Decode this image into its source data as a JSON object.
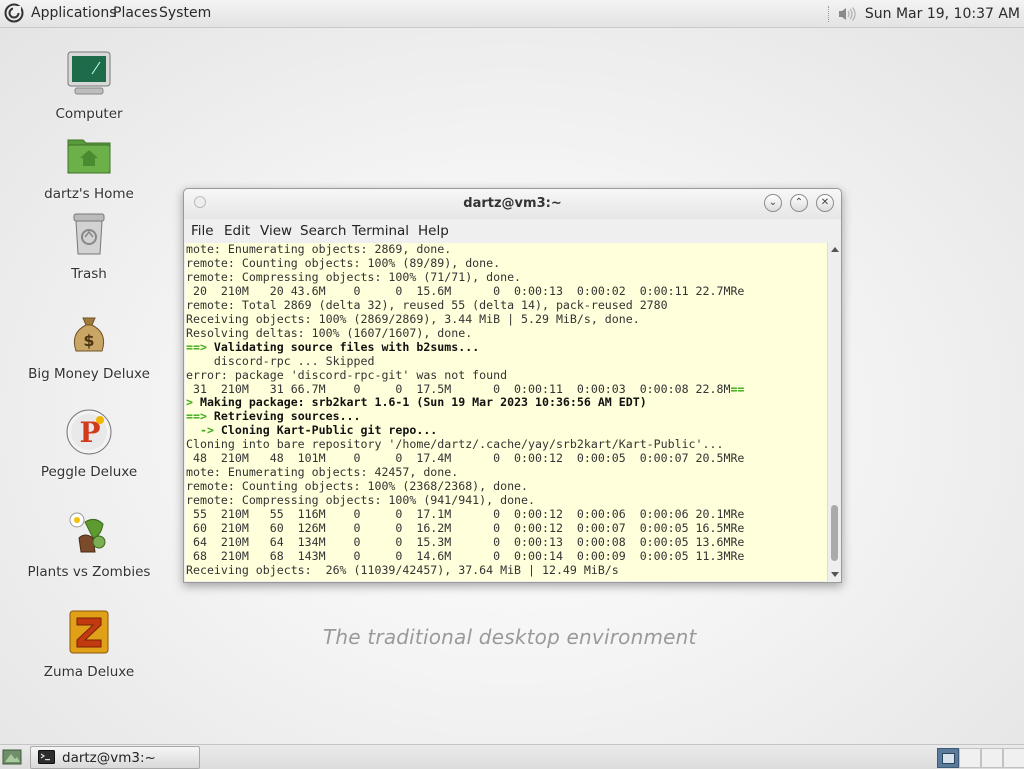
{
  "top_panel": {
    "menus": [
      "Applications",
      "Places",
      "System"
    ],
    "clock": "Sun Mar 19, 10:37 AM",
    "tray_icon": "volume-icon"
  },
  "desktop": {
    "icons": [
      {
        "label": "Computer",
        "icon": "computer-icon"
      },
      {
        "label": "dartz's Home",
        "icon": "home-folder-icon"
      },
      {
        "label": "Trash",
        "icon": "trash-icon"
      },
      {
        "label": "Big Money Deluxe",
        "icon": "money-bag-icon"
      },
      {
        "label": "Peggle Deluxe",
        "icon": "peggle-icon"
      },
      {
        "label": "Plants vs Zombies",
        "icon": "plants-vs-zombies-icon"
      },
      {
        "label": "Zuma Deluxe",
        "icon": "zuma-icon"
      }
    ],
    "tagline": "The traditional desktop environment"
  },
  "terminal": {
    "title": "dartz@vm3:~",
    "menu": [
      "File",
      "Edit",
      "View",
      "Search",
      "Terminal",
      "Help"
    ],
    "lines": [
      [
        {
          "t": "mote: Enumerating objects: 2869, done."
        }
      ],
      [
        {
          "t": "remote: Counting objects: 100% (89/89), done."
        }
      ],
      [
        {
          "t": "remote: Compressing objects: 100% (71/71), done."
        }
      ],
      [
        {
          "t": " 20  210M   20 43.6M    0     0  15.6M      0  0:00:13  0:00:02  0:00:11 22.7MRe"
        }
      ],
      [
        {
          "t": "remote: Total 2869 (delta 32), reused 55 (delta 14), pack-reused 2780"
        }
      ],
      [
        {
          "t": "Receiving objects: 100% (2869/2869), 3.44 MiB | 5.29 MiB/s, done."
        }
      ],
      [
        {
          "t": "Resolving deltas: 100% (1607/1607), done."
        }
      ],
      [
        {
          "t": "==>",
          "s": "g"
        },
        {
          "t": " Validating source files with b2sums...",
          "s": "b"
        }
      ],
      [
        {
          "t": "    discord-rpc ... Skipped"
        }
      ],
      [
        {
          "t": "error: package 'discord-rpc-git' was not found"
        }
      ],
      [
        {
          "t": " 31  210M   31 66.7M    0     0  17.5M      0  0:00:11  0:00:03  0:00:08 22.8M"
        },
        {
          "t": "==",
          "s": "g"
        }
      ],
      [
        {
          "t": ">",
          "s": "g"
        },
        {
          "t": " Making package: srb2kart 1.6-1 (Sun 19 Mar 2023 10:36:56 AM EDT)",
          "s": "b"
        }
      ],
      [
        {
          "t": "==>",
          "s": "g"
        },
        {
          "t": " Retrieving sources...",
          "s": "b"
        }
      ],
      [
        {
          "t": "  ->",
          "s": "g"
        },
        {
          "t": " Cloning Kart-Public git repo...",
          "s": "b"
        }
      ],
      [
        {
          "t": "Cloning into bare repository '/home/dartz/.cache/yay/srb2kart/Kart-Public'..."
        }
      ],
      [
        {
          "t": " 48  210M   48  101M    0     0  17.4M      0  0:00:12  0:00:05  0:00:07 20.5MRe"
        }
      ],
      [
        {
          "t": "mote: Enumerating objects: 42457, done."
        }
      ],
      [
        {
          "t": "remote: Counting objects: 100% (2368/2368), done."
        }
      ],
      [
        {
          "t": "remote: Compressing objects: 100% (941/941), done."
        }
      ],
      [
        {
          "t": " 55  210M   55  116M    0     0  17.1M      0  0:00:12  0:00:06  0:00:06 20.1MRe"
        }
      ],
      [
        {
          "t": " 60  210M   60  126M    0     0  16.2M      0  0:00:12  0:00:07  0:00:05 16.5MRe"
        }
      ],
      [
        {
          "t": " 64  210M   64  134M    0     0  15.3M      0  0:00:13  0:00:08  0:00:05 13.6MRe"
        }
      ],
      [
        {
          "t": " 68  210M   68  143M    0     0  14.6M      0  0:00:14  0:00:09  0:00:05 11.3MRe"
        }
      ],
      [
        {
          "t": "Receiving objects:  26% (11039/42457), 37.64 MiB | 12.49 MiB/s"
        }
      ]
    ]
  },
  "bottom_panel": {
    "task_label": "dartz@vm3:~",
    "workspaces": 4,
    "active_workspace": 1
  }
}
